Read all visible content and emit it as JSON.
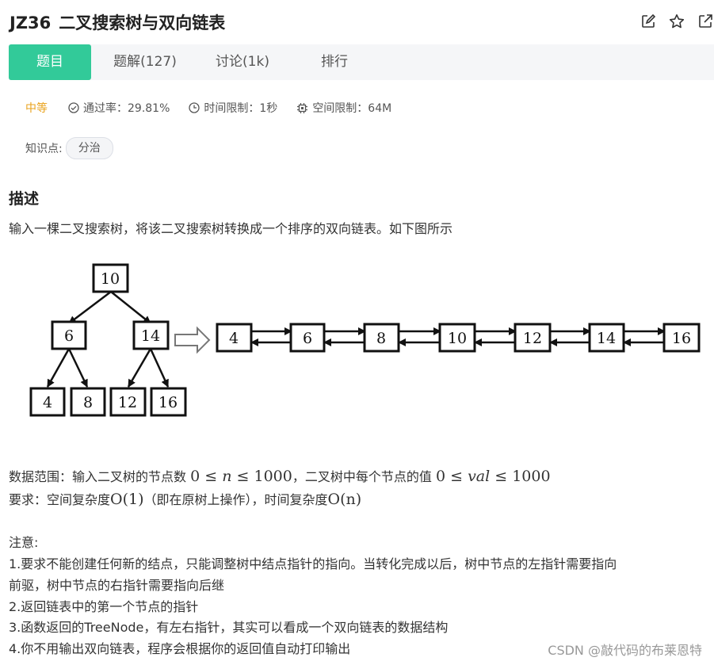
{
  "problem": {
    "code": "JZ36",
    "name": "二叉搜索树与双向链表"
  },
  "actions": {
    "icons": [
      "edit-icon",
      "star-icon",
      "share-icon"
    ]
  },
  "tabs": [
    {
      "label": "题目",
      "active": true
    },
    {
      "label": "题解(127)",
      "active": false
    },
    {
      "label": "讨论(1k)",
      "active": false
    },
    {
      "label": "排行",
      "active": false
    }
  ],
  "meta": {
    "difficulty": "中等",
    "pass_rate": "通过率：29.81%",
    "time_limit": "时间限制：1秒",
    "space_limit": "空间限制：64M"
  },
  "knowledge": {
    "label": "知识点:",
    "tag": "分治"
  },
  "description": {
    "heading": "描述",
    "text": "输入一棵二叉搜索树，将该二叉搜索树转换成一个排序的双向链表。如下图所示"
  },
  "diagram": {
    "tree_nodes": [
      "10",
      "6",
      "14",
      "4",
      "8",
      "12",
      "16"
    ],
    "list_nodes": [
      "4",
      "6",
      "8",
      "10",
      "12",
      "14",
      "16"
    ]
  },
  "range": {
    "prefix": "数据范围：输入二叉树的节点数",
    "n_expr_a": "0",
    "le": "≤",
    "n_var": "n",
    "n_max": "1000",
    "middle": "，二叉树中每个节点的值",
    "val_min": "0",
    "val_var": "val",
    "val_max": "1000"
  },
  "requirement": {
    "prefix": "要求：空间复杂度",
    "space": "O(1)",
    "middle": "（即在原树上操作），时间复杂度",
    "time": "O(n)"
  },
  "notes": {
    "heading": "注意:",
    "line1a": "1.要求不能创建任何新的结点，只能调整树中结点指针的指向。当转化完成以后，树中节点的左指针需要指向",
    "line1b": "前驱，树中节点的右指针需要指向后继",
    "line2": "2.返回链表中的第一个节点的指针",
    "line3": "3.函数返回的TreeNode，有左右指针，其实可以看成一个双向链表的数据结构",
    "line4": "4.你不用输出双向链表，程序会根据你的返回值自动打印输出"
  },
  "watermark": "CSDN @敲代码的布莱恩特"
}
